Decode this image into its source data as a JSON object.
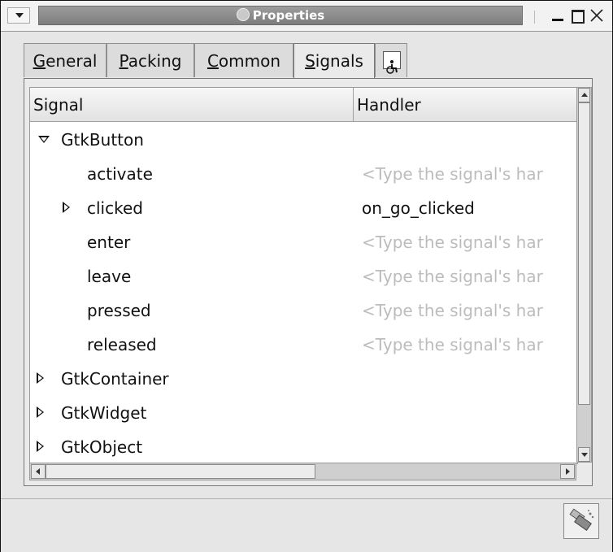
{
  "window": {
    "title": "Properties",
    "icons": {
      "menu": "menu-down-triangle-icon",
      "title": "app-icon",
      "minimize": "minimize-icon",
      "maximize": "maximize-icon",
      "close": "close-icon"
    }
  },
  "tabs": [
    {
      "label_ul": "G",
      "label_rest": "eneral"
    },
    {
      "label_ul": "P",
      "label_rest": "acking"
    },
    {
      "label_ul": "C",
      "label_rest": "ommon"
    },
    {
      "label_ul": "S",
      "label_rest": "ignals"
    },
    {
      "icon": "accessibility-icon"
    }
  ],
  "active_tab": "Signals",
  "columns": {
    "signal": "Signal",
    "handler": "Handler"
  },
  "rows": [
    {
      "name": "GtkButton",
      "handler": ""
    },
    {
      "name": "activate",
      "handler": "<Type the signal's har"
    },
    {
      "name": "clicked",
      "handler": "on_go_clicked"
    },
    {
      "name": "enter",
      "handler": "<Type the signal's har"
    },
    {
      "name": "leave",
      "handler": "<Type the signal's har"
    },
    {
      "name": "pressed",
      "handler": "<Type the signal's har"
    },
    {
      "name": "released",
      "handler": "<Type the signal's har"
    },
    {
      "name": "GtkContainer",
      "handler": ""
    },
    {
      "name": "GtkWidget",
      "handler": ""
    },
    {
      "name": "GtkObject",
      "handler": ""
    }
  ],
  "clear_button_icon": "broom-clear-icon"
}
